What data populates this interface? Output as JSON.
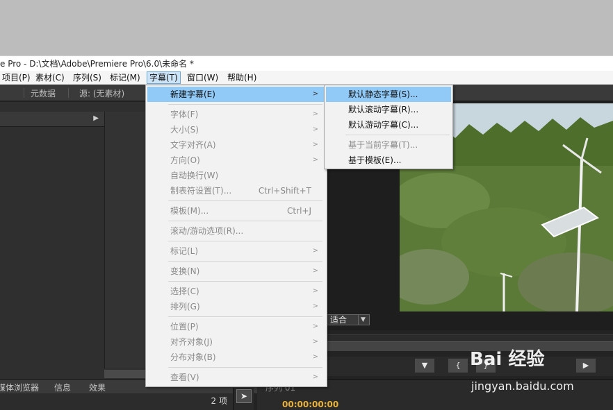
{
  "window": {
    "title": "e Pro - D:\\文档\\Adobe\\Premiere Pro\\6.0\\未命名 *"
  },
  "menubar": {
    "items": [
      {
        "label": "项目(P)"
      },
      {
        "label": "素材(C)"
      },
      {
        "label": "序列(S)"
      },
      {
        "label": "标记(M)"
      },
      {
        "label": "字幕(T)",
        "active": true
      },
      {
        "label": "窗口(W)"
      },
      {
        "label": "帮助(H)"
      }
    ]
  },
  "panels": {
    "top_tabs": [
      "元数据",
      "源: (无素材)"
    ],
    "bottom_tabs": [
      "媒体浏览器",
      "信息",
      "效果"
    ],
    "items_count": "2 项",
    "sequence_tab": "序列 01",
    "timecode": "00:00:00:00",
    "fit_label": "适合"
  },
  "title_menu": {
    "items": [
      {
        "label": "新建字幕(E)",
        "enabled": true,
        "submenu": true,
        "highlighted": true
      },
      {
        "label": "字体(F)",
        "enabled": false,
        "submenu": true
      },
      {
        "label": "大小(S)",
        "enabled": false,
        "submenu": true
      },
      {
        "label": "文字对齐(A)",
        "enabled": false,
        "submenu": true
      },
      {
        "label": "方向(O)",
        "enabled": false,
        "submenu": true
      },
      {
        "label": "自动换行(W)",
        "enabled": false
      },
      {
        "label": "制表符设置(T)...",
        "enabled": false,
        "shortcut": "Ctrl+Shift+T"
      },
      {
        "label": "模板(M)...",
        "enabled": false,
        "shortcut": "Ctrl+J"
      },
      {
        "label": "滚动/游动选项(R)...",
        "enabled": false
      },
      {
        "label": "标记(L)",
        "enabled": false,
        "submenu": true
      },
      {
        "label": "变换(N)",
        "enabled": false,
        "submenu": true
      },
      {
        "label": "选择(C)",
        "enabled": false,
        "submenu": true
      },
      {
        "label": "排列(G)",
        "enabled": false,
        "submenu": true
      },
      {
        "label": "位置(P)",
        "enabled": false,
        "submenu": true
      },
      {
        "label": "对齐对象(J)",
        "enabled": false,
        "submenu": true
      },
      {
        "label": "分布对象(B)",
        "enabled": false,
        "submenu": true
      },
      {
        "label": "查看(V)",
        "enabled": false,
        "submenu": true
      }
    ]
  },
  "new_title_submenu": {
    "items": [
      {
        "label": "默认静态字幕(S)...",
        "enabled": true,
        "highlighted": true
      },
      {
        "label": "默认滚动字幕(R)...",
        "enabled": true
      },
      {
        "label": "默认游动字幕(C)...",
        "enabled": true
      },
      {
        "label": "基于当前字幕(T)...",
        "enabled": false
      },
      {
        "label": "基于模板(E)...",
        "enabled": true
      }
    ]
  },
  "icons": {
    "submenu_arrow": "chevron-right-icon",
    "dropdown_caret": "chevron-down-icon",
    "selection_tool": "arrow-pointer-icon",
    "marker": "marker-icon",
    "in_point": "in-point-icon",
    "out_point": "out-point-icon",
    "play": "play-icon"
  },
  "watermark": {
    "logo": "Bai 经验",
    "url": "jingyan.baidu.com"
  },
  "colors": {
    "menu_highlight": "#91c9f7",
    "app_background": "#232323",
    "timecode": "#e8b23a"
  }
}
